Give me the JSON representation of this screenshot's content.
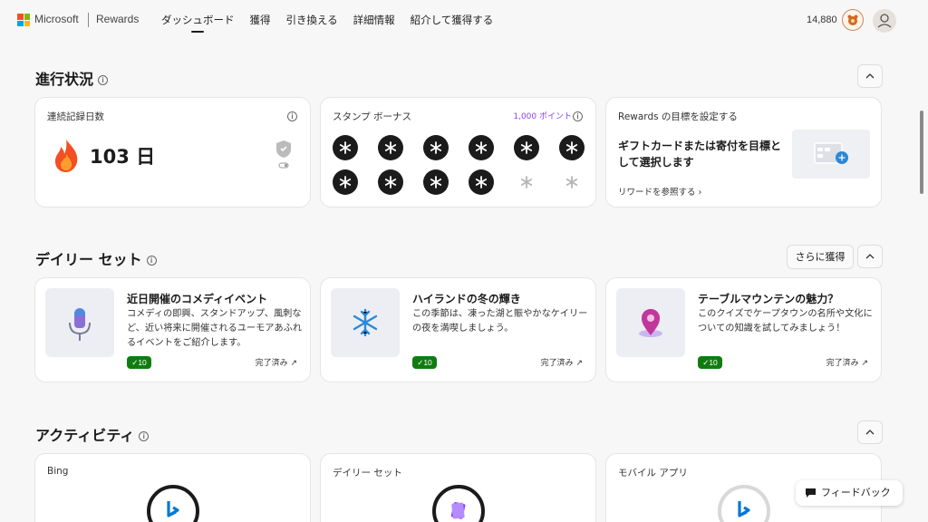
{
  "header": {
    "brand": "Microsoft",
    "product": "Rewards",
    "nav": [
      "ダッシュボード",
      "獲得",
      "引き換える",
      "詳細情報",
      "紹介して獲得する"
    ],
    "points": "14,880"
  },
  "progress": {
    "title": "進行状況",
    "streak": {
      "label": "連続記録日数",
      "value": "103 日"
    },
    "stamp": {
      "label": "スタンプ ボーナス",
      "points": "1,000 ポイント",
      "filled": 10,
      "total": 12
    },
    "goal": {
      "label": "Rewards の目標を設定する",
      "text": "ギフトカードまたは寄付を目標として選択します",
      "link": "リワードを参照する"
    }
  },
  "daily": {
    "title": "デイリー セット",
    "more": "さらに獲得",
    "cards": [
      {
        "title": "近日開催のコメディイベント",
        "desc": "コメディの即興、スタンドアップ、風刺など、近い将来に開催されるユーモアあふれるイベントをご紹介します。",
        "points": "10",
        "status": "完了済み"
      },
      {
        "title": "ハイランドの冬の輝き",
        "desc": "この季節は、凍った湖と賑やかなケイリーの夜を満喫しましょう。",
        "points": "10",
        "status": "完了済み"
      },
      {
        "title": "テーブルマウンテンの魅力？",
        "desc": "このクイズでケープタウンの名所や文化についての知識を試してみましょう！",
        "points": "10",
        "status": "完了済み"
      }
    ]
  },
  "activity": {
    "title": "アクティビティ",
    "cards": [
      {
        "label": "Bing"
      },
      {
        "label": "デイリー セット"
      },
      {
        "label": "モバイル アプリ"
      }
    ]
  },
  "feedback": "フィードバック",
  "colors": {
    "accent": "#8a3ffc",
    "success": "#107c10",
    "bing": "#0078d4"
  }
}
